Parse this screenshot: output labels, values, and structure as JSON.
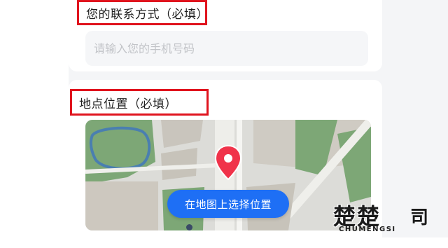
{
  "contact": {
    "label": "您的联系方式（必填）",
    "placeholder": "请输入您的手机号码",
    "value": ""
  },
  "location": {
    "label": "地点位置（必填）",
    "select_button": "在地图上选择位置"
  },
  "watermark": {
    "logo": "楚楚",
    "char": "司",
    "subtitle": "CHUMENGSI"
  },
  "colors": {
    "accent": "#1e6ff5",
    "highlight_border": "#e0141e",
    "pin": "#f0334a"
  }
}
